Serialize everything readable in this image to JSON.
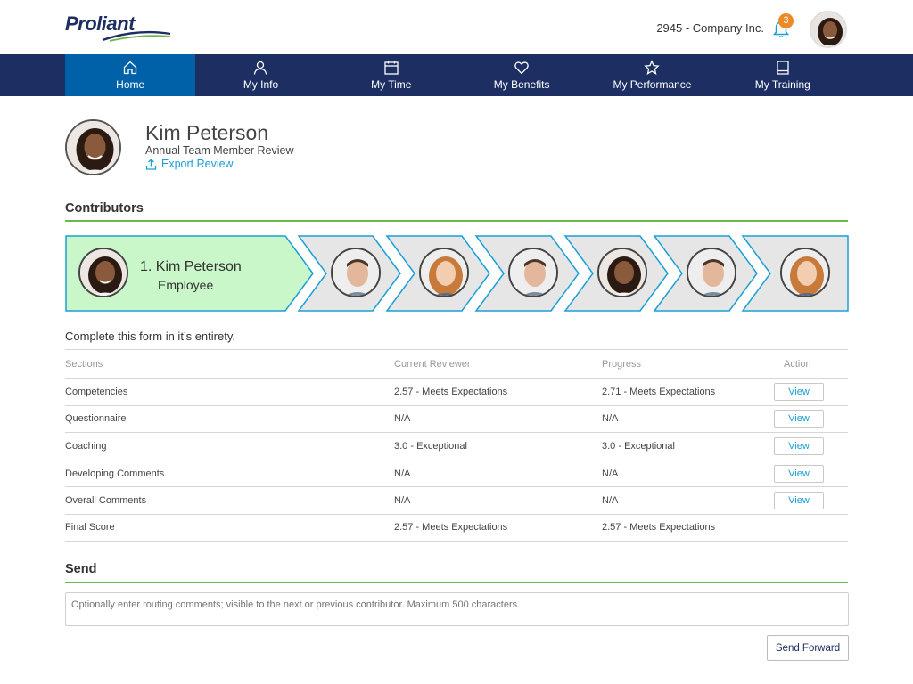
{
  "header": {
    "logo_text": "Proliant",
    "company": "2945 - Company Inc.",
    "notifications_count": "3"
  },
  "nav": {
    "items": [
      {
        "label": "Home",
        "icon": "home-icon",
        "active": true
      },
      {
        "label": "My Info",
        "icon": "user-icon"
      },
      {
        "label": "My Time",
        "icon": "calendar-icon"
      },
      {
        "label": "My Benefits",
        "icon": "heart-icon"
      },
      {
        "label": "My Performance",
        "icon": "star-icon"
      },
      {
        "label": "My Training",
        "icon": "book-icon"
      }
    ]
  },
  "profile": {
    "name": "Kim Peterson",
    "subtitle": "Annual Team Member Review",
    "export_label": "Export Review"
  },
  "contributors": {
    "title": "Contributors",
    "current": {
      "name": "1. Kim Peterson",
      "role": "Employee"
    },
    "steps": [
      "man",
      "woman-blonde",
      "man",
      "woman-dark",
      "man",
      "woman-blonde"
    ]
  },
  "instructions": "Complete this form in it’s entirety.",
  "table": {
    "headers": [
      "Sections",
      "Current Reviewer",
      "Progress",
      "Action"
    ],
    "rows": [
      {
        "section": "Competencies",
        "current": "2.57 - Meets Expectations",
        "progress": "2.71 - Meets Expectations",
        "action": "View"
      },
      {
        "section": "Questionnaire",
        "current": "N/A",
        "progress": "N/A",
        "action": "View"
      },
      {
        "section": "Coaching",
        "current": "3.0 - Exceptional",
        "progress": "3.0 - Exceptional",
        "action": "View"
      },
      {
        "section": "Developing Comments",
        "current": "N/A",
        "progress": "N/A",
        "action": "View"
      },
      {
        "section": "Overall Comments",
        "current": "N/A",
        "progress": "N/A",
        "action": "View"
      },
      {
        "section": "Final Score",
        "current": "2.57 - Meets Expectations",
        "progress": "2.57 - Meets Expectations",
        "action": ""
      }
    ]
  },
  "send": {
    "title": "Send",
    "placeholder": "Optionally enter routing comments; visible to the next or previous contributor. Maximum 500 characters.",
    "button_label": "Send Forward"
  },
  "colors": {
    "navy": "#1d2e62",
    "nav_active": "#0060a8",
    "accent_blue": "#1a9fd6",
    "green_line": "#6cb84a",
    "current_step_bg": "#c9f7c9",
    "badge_orange": "#ee8a26"
  }
}
